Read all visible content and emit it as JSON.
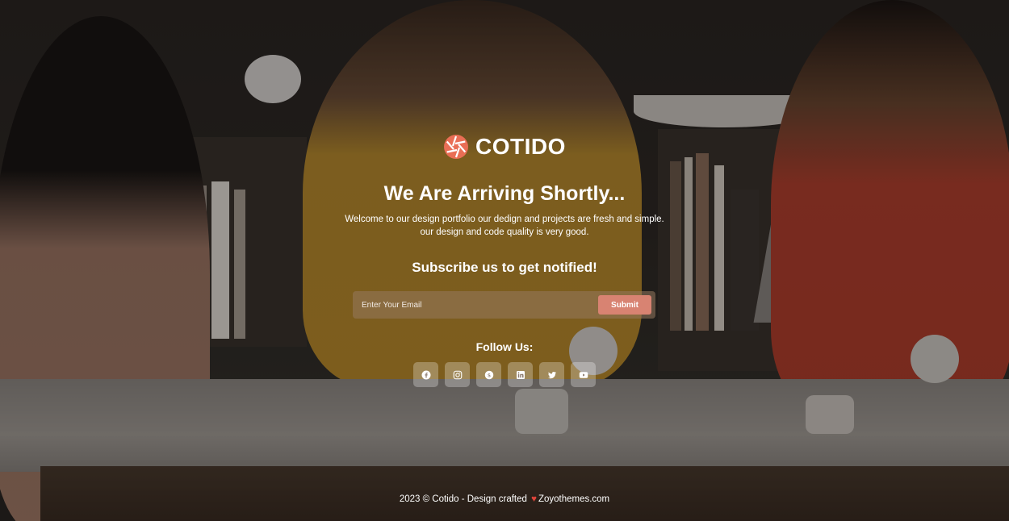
{
  "brand": {
    "name": "COTIDO",
    "logo_icon": "aperture-icon",
    "accent": "#e96e55"
  },
  "hero": {
    "title": "We Are Arriving Shortly...",
    "description": "Welcome to our design portfolio our dedign and projects are fresh and simple. our design and code quality is very good."
  },
  "subscribe": {
    "title": "Subscribe us to get notified!",
    "placeholder": "Enter Your Email",
    "button_label": "Submit",
    "button_color": "#d88372"
  },
  "follow": {
    "title": "Follow Us:",
    "icons": [
      "facebook-icon",
      "instagram-icon",
      "skype-icon",
      "linkedin-icon",
      "twitter-icon",
      "youtube-icon"
    ]
  },
  "footer": {
    "prefix": "2023 © Cotido - Design crafted",
    "heart": "♥",
    "suffix": "Zoyothemes.com"
  }
}
